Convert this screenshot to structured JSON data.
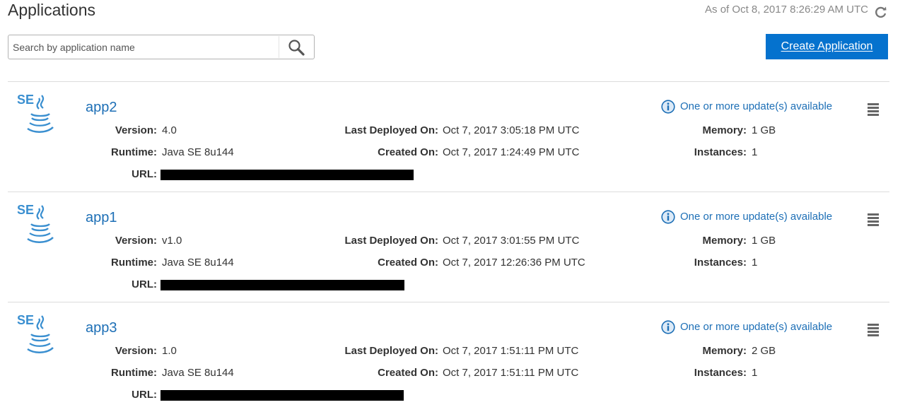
{
  "header": {
    "title": "Applications",
    "as_of": "As of Oct 8, 2017 8:26:29 AM UTC",
    "refresh_icon": "refresh-icon"
  },
  "search": {
    "placeholder": "Search by application name",
    "value": "",
    "icon": "search-icon"
  },
  "create_button": {
    "label": "Create Application",
    "color": "#0572ce"
  },
  "labels": {
    "version": "Version:",
    "runtime": "Runtime:",
    "url": "URL:",
    "last_deployed": "Last Deployed On:",
    "created": "Created On:",
    "memory": "Memory:",
    "instances": "Instances:"
  },
  "apps": [
    {
      "name": "app2",
      "logo_text": "SE",
      "update_notice": "One or more update(s) available",
      "version": "4.0",
      "runtime": "Java SE 8u144",
      "last_deployed": "Oct 7, 2017 3:05:18 PM UTC",
      "created": "Oct 7, 2017 1:24:49 PM UTC",
      "memory": "1 GB",
      "instances": "1"
    },
    {
      "name": "app1",
      "logo_text": "SE",
      "update_notice": "One or more update(s) available",
      "version": "v1.0",
      "runtime": "Java SE 8u144",
      "last_deployed": "Oct 7, 2017 3:01:55 PM UTC",
      "created": "Oct 7, 2017 12:26:36 PM UTC",
      "memory": "1 GB",
      "instances": "1"
    },
    {
      "name": "app3",
      "logo_text": "SE",
      "update_notice": "One or more update(s) available",
      "version": "1.0",
      "runtime": "Java SE 8u144",
      "last_deployed": "Oct 7, 2017 1:51:11 PM UTC",
      "created": "Oct 7, 2017 1:51:11 PM UTC",
      "memory": "2 GB",
      "instances": "1"
    }
  ],
  "colors": {
    "link": "#1d6fb6",
    "logo": "#3a8fd0",
    "redaction": "#000000"
  }
}
